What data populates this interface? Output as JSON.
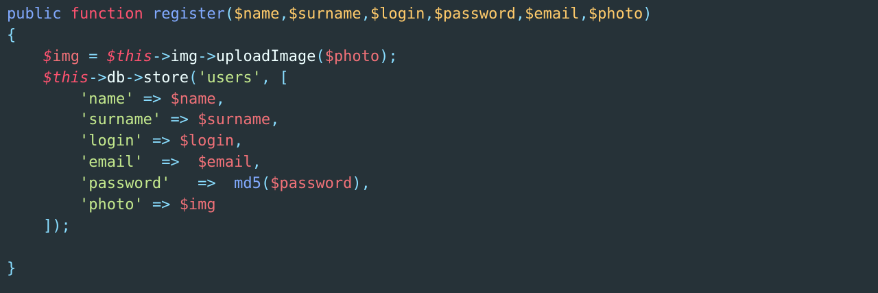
{
  "code": {
    "lines": [
      {
        "tokens": [
          {
            "t": "public",
            "c": "tok-public"
          },
          {
            "t": " ",
            "c": "tok-plain"
          },
          {
            "t": "function",
            "c": "tok-function"
          },
          {
            "t": " ",
            "c": "tok-plain"
          },
          {
            "t": "register",
            "c": "tok-fname"
          },
          {
            "t": "(",
            "c": "tok-punc"
          },
          {
            "t": "$",
            "c": "tok-param"
          },
          {
            "t": "name",
            "c": "tok-param"
          },
          {
            "t": ",",
            "c": "tok-punc"
          },
          {
            "t": "$",
            "c": "tok-param"
          },
          {
            "t": "surname",
            "c": "tok-param"
          },
          {
            "t": ",",
            "c": "tok-punc"
          },
          {
            "t": "$",
            "c": "tok-param"
          },
          {
            "t": "login",
            "c": "tok-param"
          },
          {
            "t": ",",
            "c": "tok-punc"
          },
          {
            "t": "$",
            "c": "tok-param"
          },
          {
            "t": "password",
            "c": "tok-param"
          },
          {
            "t": ",",
            "c": "tok-punc"
          },
          {
            "t": "$",
            "c": "tok-param"
          },
          {
            "t": "email",
            "c": "tok-param"
          },
          {
            "t": ",",
            "c": "tok-punc"
          },
          {
            "t": "$",
            "c": "tok-param"
          },
          {
            "t": "photo",
            "c": "tok-param"
          },
          {
            "t": ")",
            "c": "tok-punc"
          }
        ]
      },
      {
        "tokens": [
          {
            "t": "{",
            "c": "tok-brace"
          }
        ]
      },
      {
        "tokens": [
          {
            "t": "    ",
            "c": "tok-plain"
          },
          {
            "t": "$",
            "c": "tok-this"
          },
          {
            "t": "img",
            "c": "tok-var"
          },
          {
            "t": " ",
            "c": "tok-plain"
          },
          {
            "t": "=",
            "c": "tok-op"
          },
          {
            "t": " ",
            "c": "tok-plain"
          },
          {
            "t": "$this",
            "c": "tok-this"
          },
          {
            "t": "->",
            "c": "tok-op"
          },
          {
            "t": "img",
            "c": "tok-plain"
          },
          {
            "t": "->",
            "c": "tok-op"
          },
          {
            "t": "uploadImage",
            "c": "tok-plain"
          },
          {
            "t": "(",
            "c": "tok-punc"
          },
          {
            "t": "$",
            "c": "tok-var"
          },
          {
            "t": "photo",
            "c": "tok-var"
          },
          {
            "t": ");",
            "c": "tok-punc"
          }
        ]
      },
      {
        "tokens": [
          {
            "t": "    ",
            "c": "tok-plain"
          },
          {
            "t": "$this",
            "c": "tok-this"
          },
          {
            "t": "->",
            "c": "tok-op"
          },
          {
            "t": "db",
            "c": "tok-plain"
          },
          {
            "t": "->",
            "c": "tok-op"
          },
          {
            "t": "store",
            "c": "tok-plain"
          },
          {
            "t": "(",
            "c": "tok-punc"
          },
          {
            "t": "'users'",
            "c": "tok-str"
          },
          {
            "t": ", ",
            "c": "tok-punc"
          },
          {
            "t": "[",
            "c": "tok-punc"
          }
        ]
      },
      {
        "tokens": [
          {
            "t": "        ",
            "c": "tok-plain"
          },
          {
            "t": "'name'",
            "c": "tok-str"
          },
          {
            "t": " ",
            "c": "tok-plain"
          },
          {
            "t": "=>",
            "c": "tok-op"
          },
          {
            "t": " ",
            "c": "tok-plain"
          },
          {
            "t": "$name",
            "c": "tok-var"
          },
          {
            "t": ",",
            "c": "tok-punc"
          }
        ]
      },
      {
        "tokens": [
          {
            "t": "        ",
            "c": "tok-plain"
          },
          {
            "t": "'surname'",
            "c": "tok-str"
          },
          {
            "t": " ",
            "c": "tok-plain"
          },
          {
            "t": "=>",
            "c": "tok-op"
          },
          {
            "t": " ",
            "c": "tok-plain"
          },
          {
            "t": "$surname",
            "c": "tok-var"
          },
          {
            "t": ",",
            "c": "tok-punc"
          }
        ]
      },
      {
        "tokens": [
          {
            "t": "        ",
            "c": "tok-plain"
          },
          {
            "t": "'login'",
            "c": "tok-str"
          },
          {
            "t": " ",
            "c": "tok-plain"
          },
          {
            "t": "=>",
            "c": "tok-op"
          },
          {
            "t": " ",
            "c": "tok-plain"
          },
          {
            "t": "$login",
            "c": "tok-var"
          },
          {
            "t": ",",
            "c": "tok-punc"
          }
        ]
      },
      {
        "tokens": [
          {
            "t": "        ",
            "c": "tok-plain"
          },
          {
            "t": "'email'",
            "c": "tok-str"
          },
          {
            "t": "  ",
            "c": "tok-plain"
          },
          {
            "t": "=>",
            "c": "tok-op"
          },
          {
            "t": "  ",
            "c": "tok-plain"
          },
          {
            "t": "$email",
            "c": "tok-var"
          },
          {
            "t": ",",
            "c": "tok-punc"
          }
        ]
      },
      {
        "tokens": [
          {
            "t": "        ",
            "c": "tok-plain"
          },
          {
            "t": "'password'",
            "c": "tok-str"
          },
          {
            "t": "   ",
            "c": "tok-plain"
          },
          {
            "t": "=>",
            "c": "tok-op"
          },
          {
            "t": "  ",
            "c": "tok-plain"
          },
          {
            "t": "md5",
            "c": "tok-builtin"
          },
          {
            "t": "(",
            "c": "tok-punc"
          },
          {
            "t": "$password",
            "c": "tok-var"
          },
          {
            "t": "),",
            "c": "tok-punc"
          }
        ]
      },
      {
        "tokens": [
          {
            "t": "        ",
            "c": "tok-plain"
          },
          {
            "t": "'photo'",
            "c": "tok-str"
          },
          {
            "t": " ",
            "c": "tok-plain"
          },
          {
            "t": "=>",
            "c": "tok-op"
          },
          {
            "t": " ",
            "c": "tok-plain"
          },
          {
            "t": "$img",
            "c": "tok-var"
          }
        ]
      },
      {
        "tokens": [
          {
            "t": "    ",
            "c": "tok-plain"
          },
          {
            "t": "]);",
            "c": "tok-punc"
          }
        ]
      },
      {
        "tokens": []
      },
      {
        "tokens": [
          {
            "t": "}",
            "c": "tok-brace"
          }
        ]
      }
    ]
  },
  "colors": {
    "background": "#263238",
    "keyword_public": "#82aaff",
    "keyword_function": "#ff5370",
    "function_name": "#82aaff",
    "parameter": "#ffcb6b",
    "variable": "#f07178",
    "this": "#ff5370",
    "string": "#c3e88d",
    "operator": "#89ddff",
    "plain": "#eeffff"
  }
}
